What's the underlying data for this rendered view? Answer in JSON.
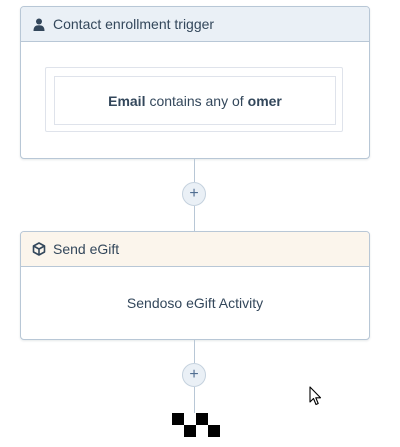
{
  "trigger": {
    "title": "Contact enrollment trigger",
    "icon": "contact-person-icon",
    "header_color": "#eaf0f6",
    "filter": {
      "property": "Email",
      "operator": "contains any of",
      "value": "omer"
    }
  },
  "add_step": {
    "label": "+"
  },
  "action": {
    "title": "Send eGift",
    "icon": "cube-icon",
    "header_color": "#fbf5ec",
    "description": "Sendoso eGift Activity"
  },
  "colors": {
    "border": "#b8c7d6",
    "text": "#33475b"
  }
}
